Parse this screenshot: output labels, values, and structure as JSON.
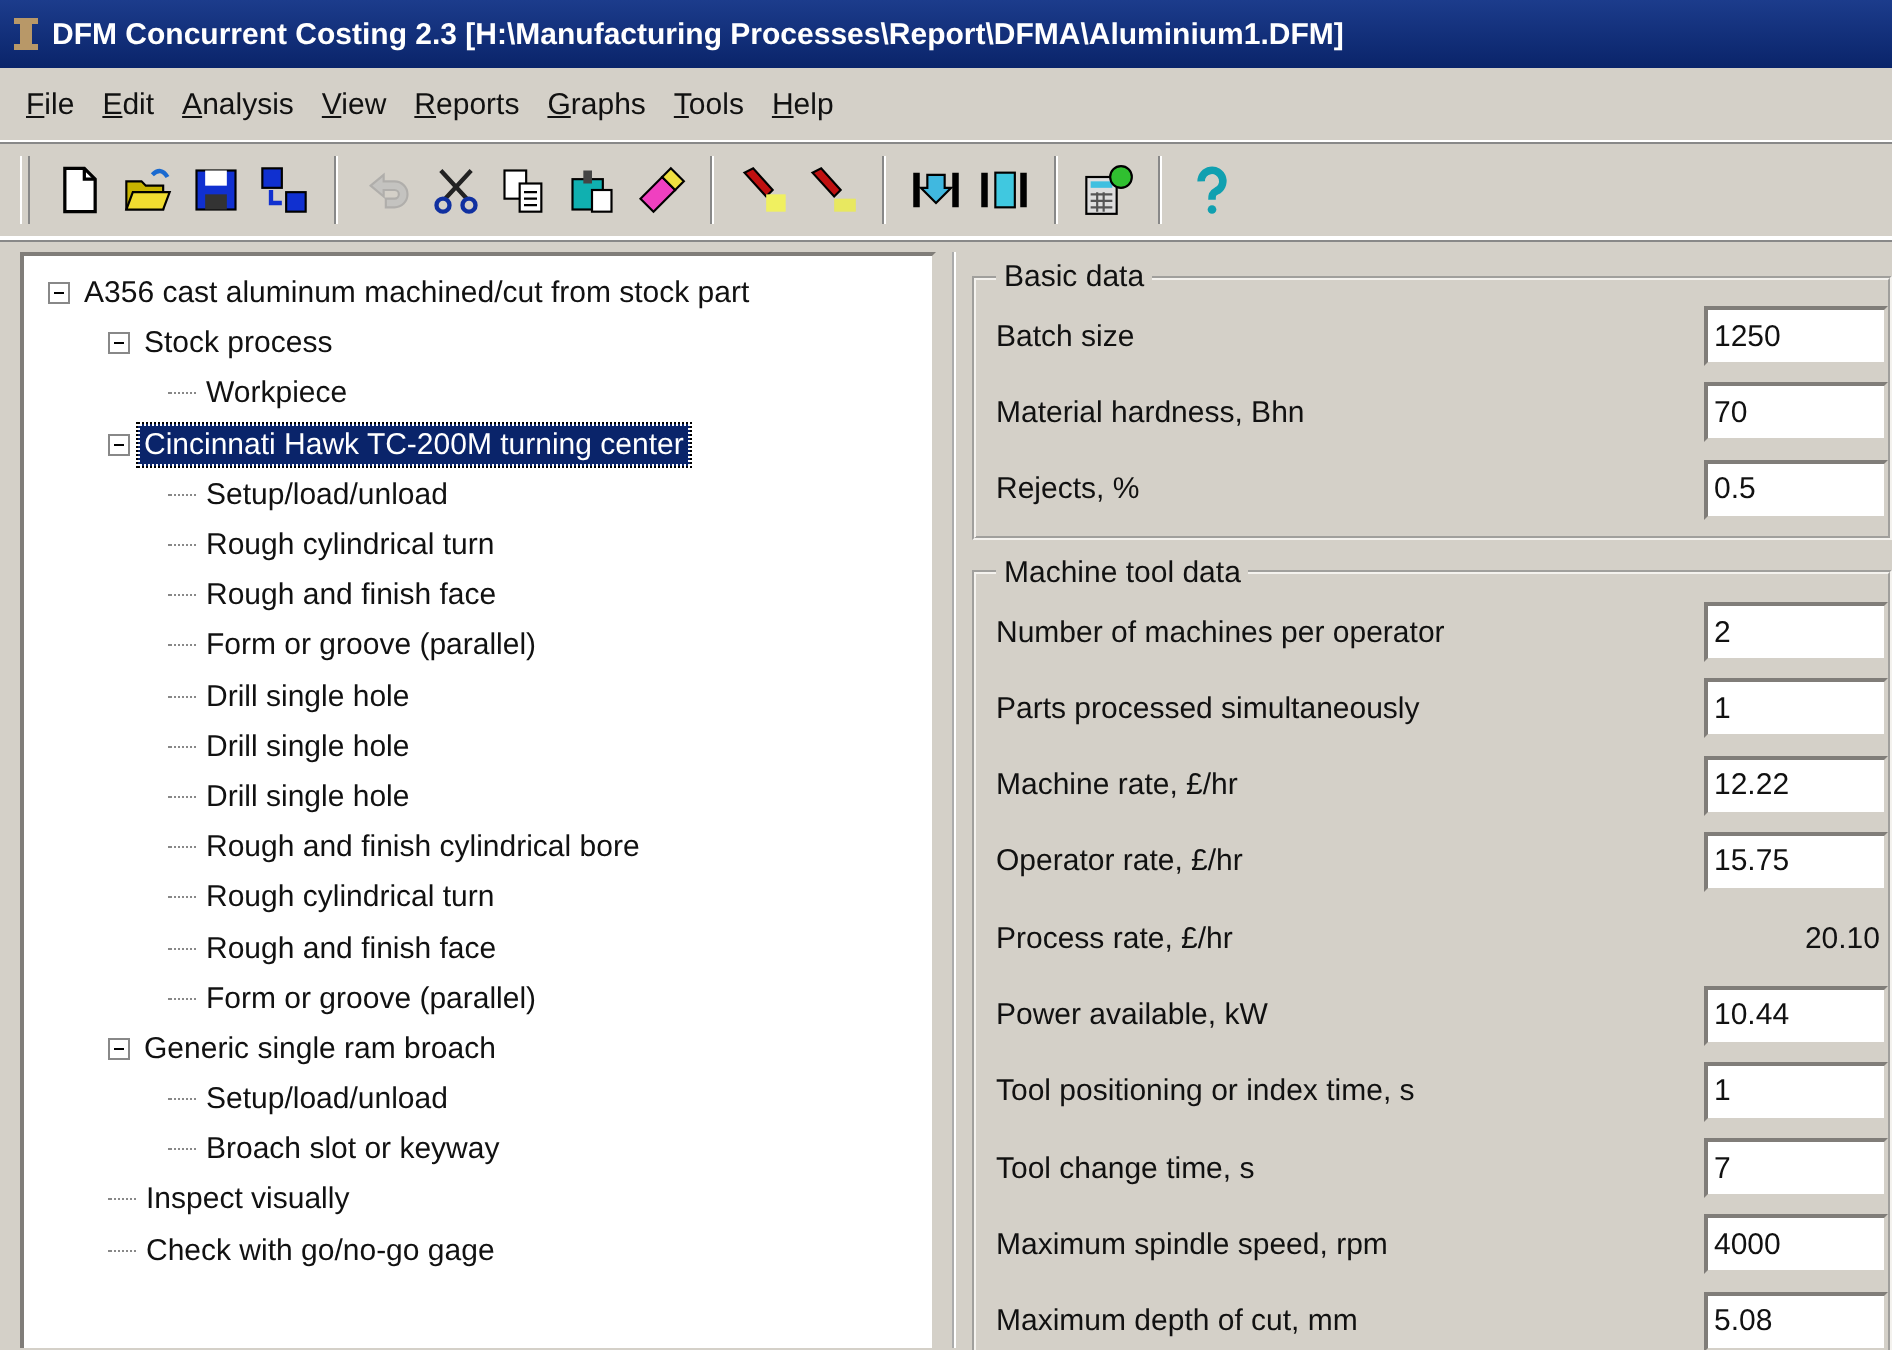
{
  "window": {
    "title": "DFM Concurrent Costing 2.3 [H:\\Manufacturing Processes\\Report\\DFMA\\Aluminium1.DFM]"
  },
  "menu": [
    "File",
    "Edit",
    "Analysis",
    "View",
    "Reports",
    "Graphs",
    "Tools",
    "Help"
  ],
  "toolbar": [
    [
      {
        "kind": "new",
        "disabled": false
      },
      {
        "kind": "open",
        "disabled": false
      },
      {
        "kind": "save",
        "disabled": false
      },
      {
        "kind": "saveas",
        "disabled": false
      }
    ],
    [
      {
        "kind": "undo",
        "disabled": true
      },
      {
        "kind": "cut",
        "disabled": false
      },
      {
        "kind": "copy",
        "disabled": false
      },
      {
        "kind": "paste",
        "disabled": false
      },
      {
        "kind": "eraser",
        "disabled": false
      }
    ],
    [
      {
        "kind": "torch",
        "disabled": false
      },
      {
        "kind": "torch2",
        "disabled": false
      }
    ],
    [
      {
        "kind": "insert",
        "disabled": false
      },
      {
        "kind": "bracket",
        "disabled": false
      }
    ],
    [
      {
        "kind": "calc",
        "disabled": false
      }
    ],
    [
      {
        "kind": "help",
        "disabled": false
      }
    ]
  ],
  "tree": [
    {
      "label": "A356 cast aluminum machined/cut from stock part",
      "selected": false,
      "expanded": true,
      "children": [
        {
          "label": "Stock process",
          "selected": false,
          "expanded": true,
          "children": [
            {
              "label": "Workpiece",
              "selected": false
            }
          ]
        },
        {
          "label": "Cincinnati Hawk TC-200M turning center",
          "selected": true,
          "expanded": true,
          "children": [
            {
              "label": "Setup/load/unload",
              "selected": false
            },
            {
              "label": "Rough cylindrical turn",
              "selected": false
            },
            {
              "label": "Rough and finish face",
              "selected": false
            },
            {
              "label": "Form or groove (parallel)",
              "selected": false
            },
            {
              "label": "Drill single hole",
              "selected": false
            },
            {
              "label": "Drill single hole",
              "selected": false
            },
            {
              "label": "Drill single hole",
              "selected": false
            },
            {
              "label": "Rough and finish cylindrical bore",
              "selected": false
            },
            {
              "label": "Rough cylindrical turn",
              "selected": false
            },
            {
              "label": "Rough and finish face",
              "selected": false
            },
            {
              "label": "Form or groove (parallel)",
              "selected": false
            }
          ]
        },
        {
          "label": "Generic single ram broach",
          "selected": false,
          "expanded": true,
          "children": [
            {
              "label": "Setup/load/unload",
              "selected": false
            },
            {
              "label": "Broach slot or keyway",
              "selected": false
            }
          ]
        },
        {
          "label": "Inspect visually",
          "selected": false
        },
        {
          "label": "Check with go/no-go gage",
          "selected": false
        }
      ]
    }
  ],
  "groups": [
    {
      "title": "Basic data",
      "fields": [
        {
          "label": "Batch size",
          "value": "1250",
          "kind": "input"
        },
        {
          "label": "Material hardness, Bhn",
          "value": "70",
          "kind": "input"
        },
        {
          "label": "Rejects, %",
          "value": "0.5",
          "kind": "input"
        }
      ]
    },
    {
      "title": "Machine tool data",
      "fields": [
        {
          "label": "Number of machines per operator",
          "value": "2",
          "kind": "input"
        },
        {
          "label": "Parts processed simultaneously",
          "value": "1",
          "kind": "input"
        },
        {
          "label": "Machine rate, £/hr",
          "value": "12.22",
          "kind": "input"
        },
        {
          "label": "Operator rate, £/hr",
          "value": "15.75",
          "kind": "input"
        },
        {
          "label": "Process rate, £/hr",
          "value": "20.10",
          "kind": "readout"
        },
        {
          "label": "Power available, kW",
          "value": "10.44",
          "kind": "input"
        },
        {
          "label": "Tool positioning or index time, s",
          "value": "1",
          "kind": "input"
        },
        {
          "label": "Tool change time, s",
          "value": "7",
          "kind": "input"
        },
        {
          "label": "Maximum spindle speed, rpm",
          "value": "4000",
          "kind": "input"
        },
        {
          "label": "Maximum depth of cut, mm",
          "value": "5.08",
          "kind": "input"
        }
      ]
    }
  ]
}
